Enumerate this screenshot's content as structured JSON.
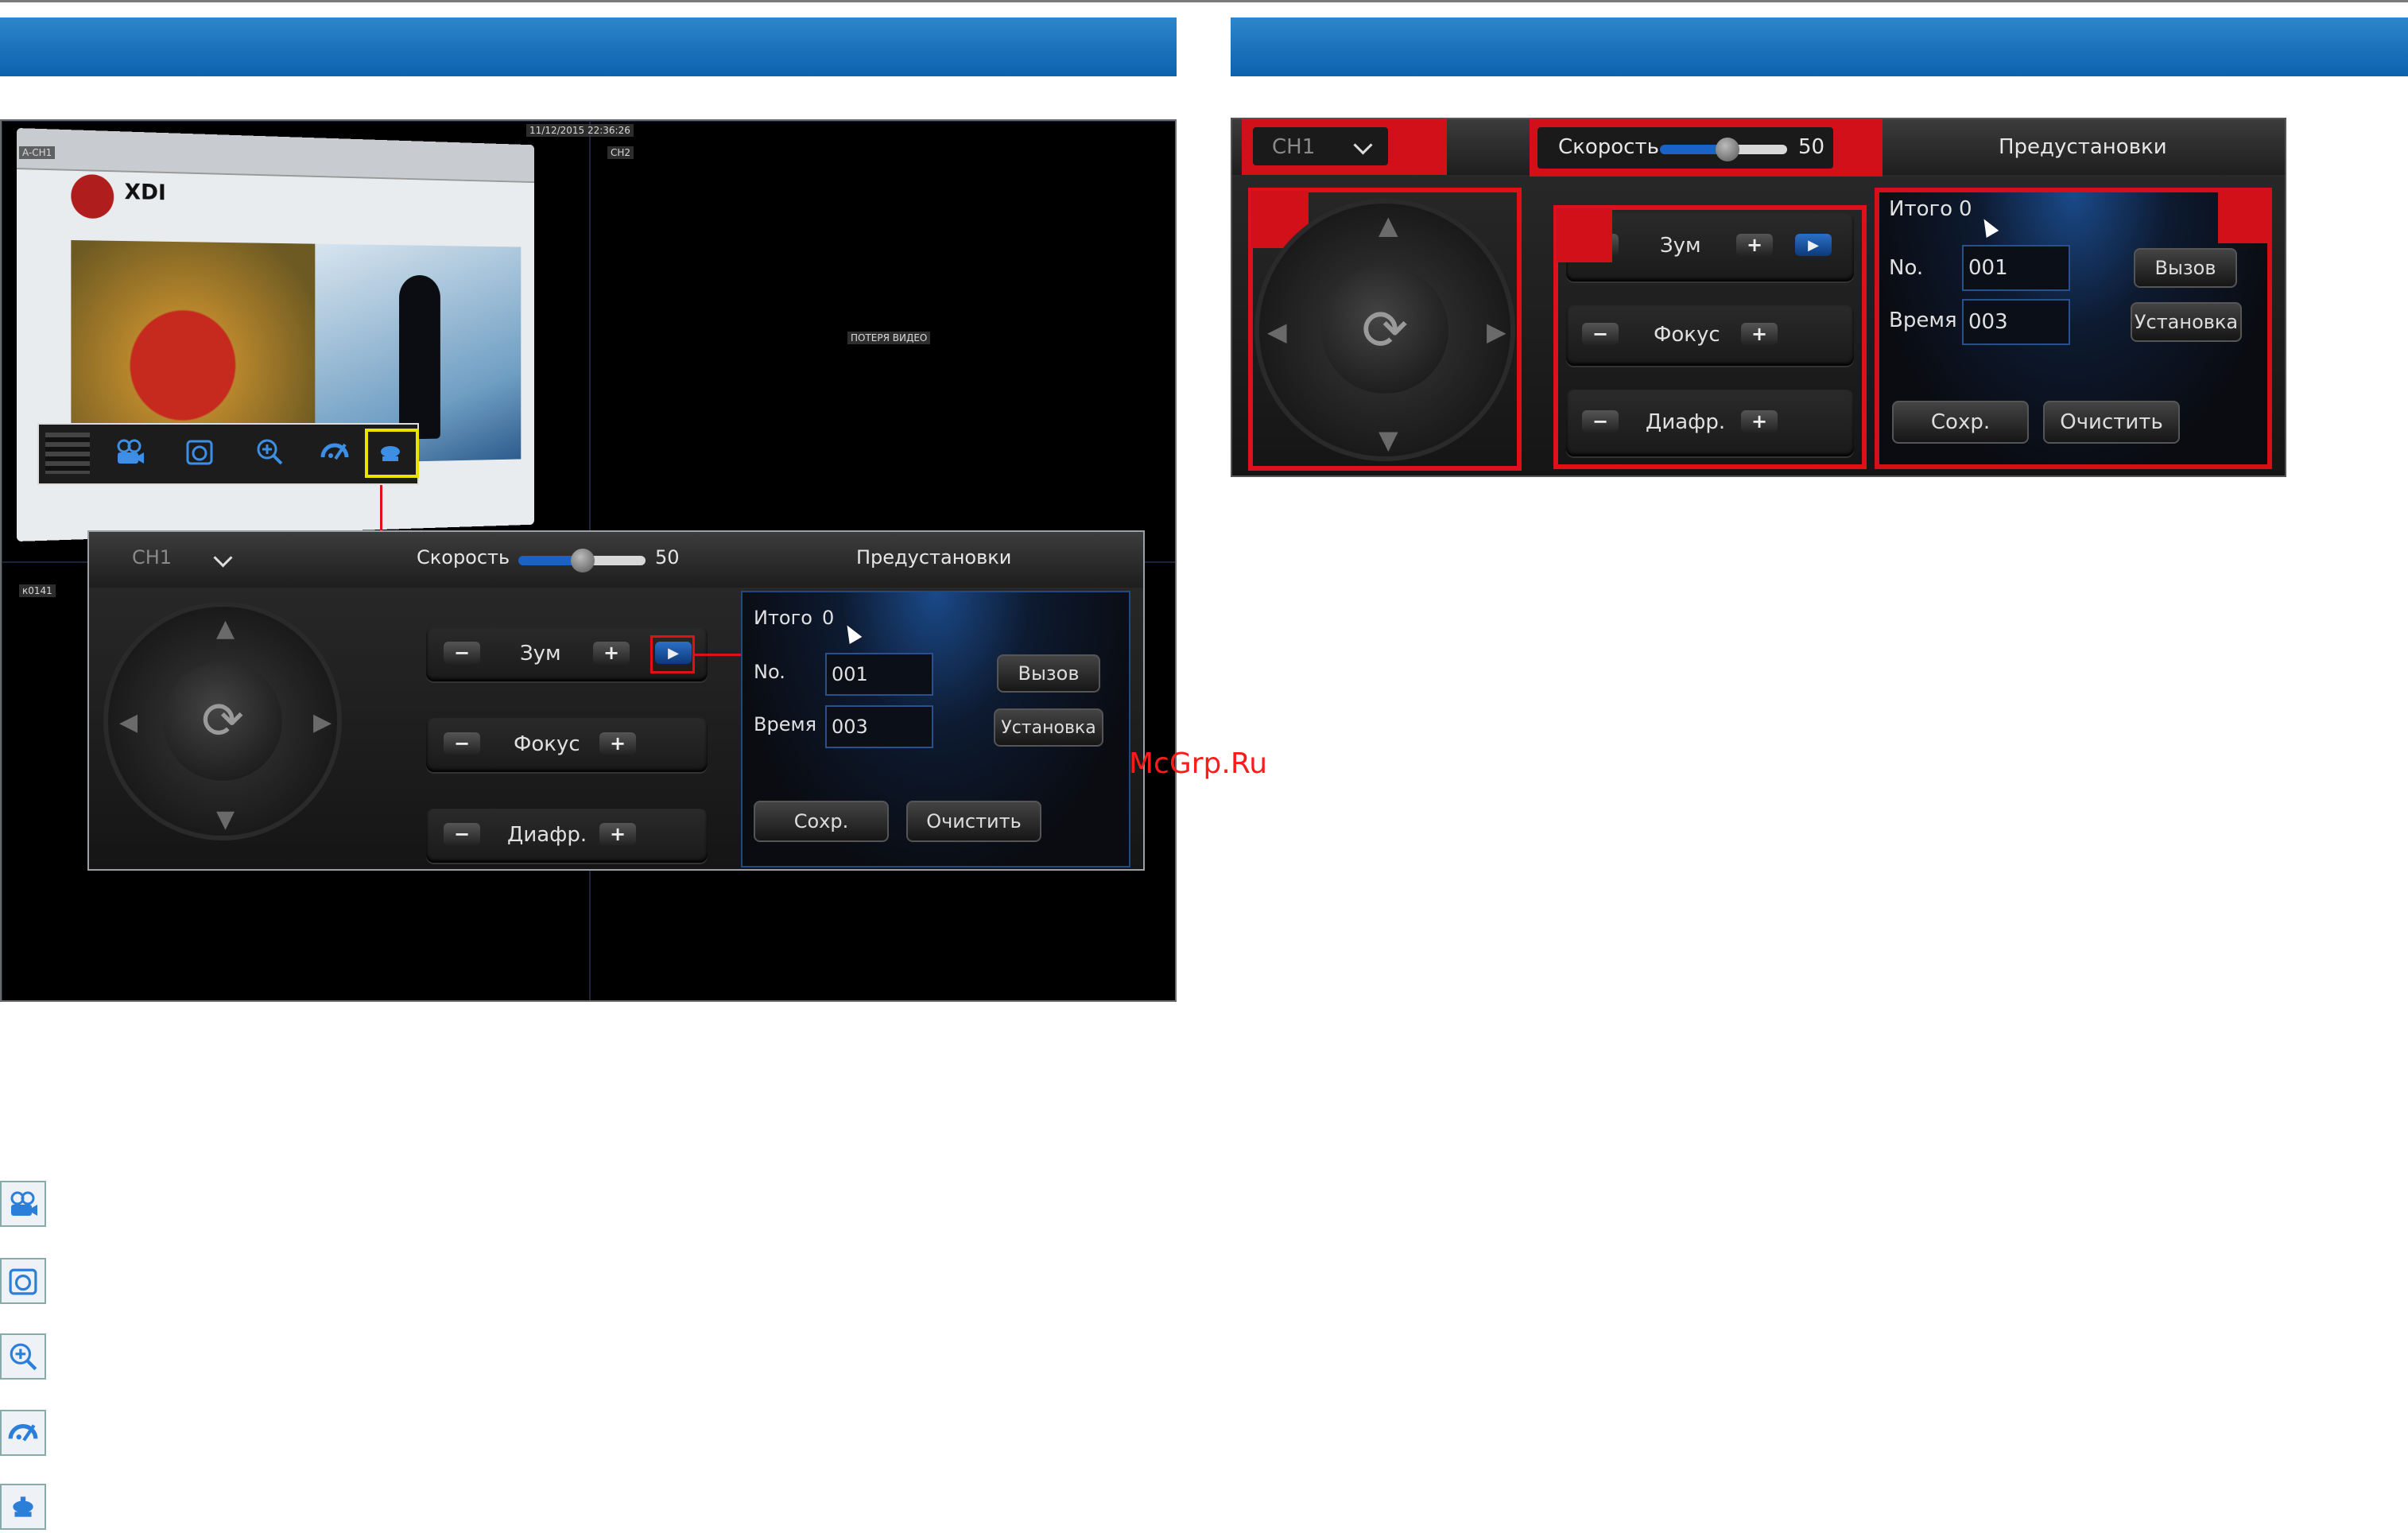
{
  "watermark": "McGrp.Ru",
  "camera": {
    "channel_a": "A-CH1",
    "timestamp": "11/12/2015 22:36:26",
    "channel_b": "CH2",
    "video_loss": "ПОТЕРЯ ВИДЕО",
    "channel_c": "к0141"
  },
  "website": {
    "brand": "XDI"
  },
  "ptz": {
    "channel": "CH1",
    "speed_label": "Скорость",
    "speed_value": "50",
    "speed_fraction": 0.5,
    "presets_title": "Предустановки",
    "zoom_label": "Зум",
    "focus_label": "Фокус",
    "iris_label": "Диафр.",
    "minus": "−",
    "plus": "+",
    "total_label": "Итого",
    "total_value": "0",
    "no_label": "No.",
    "no_value": "001",
    "time_label": "Время",
    "time_value": "003",
    "call_button": "Вызов",
    "set_button": "Установка",
    "save_button": "Сохр.",
    "clear_button": "Очистить"
  },
  "colors": {
    "accent": "#1b6fbd",
    "highlight_red": "#e0101a",
    "highlight_yellow": "#e8e400"
  },
  "icons": [
    "record-icon",
    "snapshot-icon",
    "zoom-icon",
    "color-icon",
    "ptz-icon"
  ]
}
